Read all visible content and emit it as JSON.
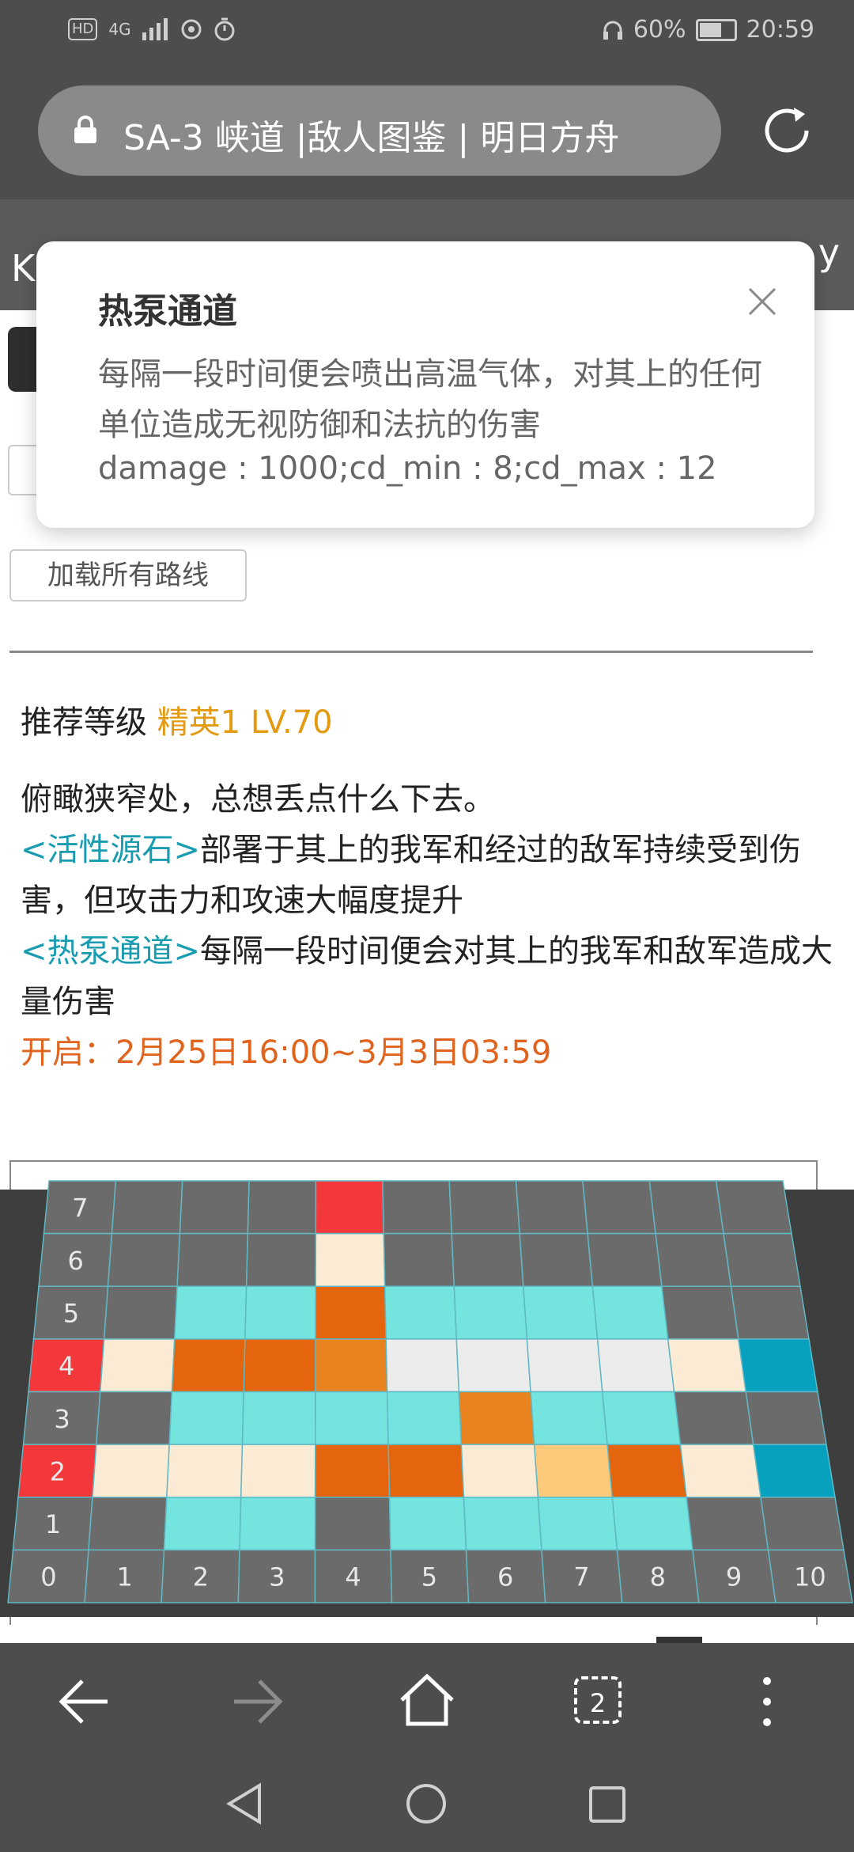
{
  "status_bar": {
    "hd": "HD",
    "network": "4G",
    "battery": "60%",
    "time": "20:59"
  },
  "address_bar": {
    "title": "SA-3 峡道 |敌人图鉴 | 明日方舟"
  },
  "page_header": {
    "left_char": "K",
    "right_char": "y"
  },
  "popup": {
    "title": "热泵通道",
    "description": "每隔一段时间便会喷出高温气体，对其上的任何单位造成无视防御和法抗的伤害",
    "stats": "damage : 1000;cd_min : 8;cd_max : 12"
  },
  "load_routes_button": "加载所有路线",
  "recommend": {
    "label": "推荐等级",
    "value": "精英1 LV.70"
  },
  "description": {
    "intro": "俯瞰狭窄处，总想丢点什么下去。",
    "tile1_name": "<活性源石>",
    "tile1_text": "部署于其上的我军和经过的敌军持续受到伤害，但攻击力和攻速大幅度提升",
    "tile2_name": "<热泵通道>",
    "tile2_text": "每隔一段时间便会对其上的我军和敌军造成大量伤害",
    "open_time": "开启：2月25日16:00~3月3日03:59"
  },
  "map": {
    "x_labels": [
      "0",
      "1",
      "2",
      "3",
      "4",
      "5",
      "6",
      "7",
      "8",
      "9",
      "10"
    ],
    "y_labels": [
      "1",
      "2",
      "3",
      "4",
      "5",
      "6",
      "7"
    ],
    "colors": {
      "G": "#6b6b6b",
      "C": "#74e4de",
      "O": "#e5650e",
      "o": "#e88320",
      "R": "#f2383a",
      "E": "#fbebd4",
      "W": "#ececec",
      "Y": "#fdc97a",
      "B": "#08a0bf"
    },
    "rows": [
      "GGGGRGGGGGG",
      "GGGGEGGGGGG",
      "GGCCOCCCCGG",
      "REOOoWWWWEB",
      "GGCCCCoCCGG",
      "REEEOOEYOEB",
      "GGCCGCCCCGG"
    ]
  },
  "bottom_nav": {
    "tab_count": "2"
  }
}
